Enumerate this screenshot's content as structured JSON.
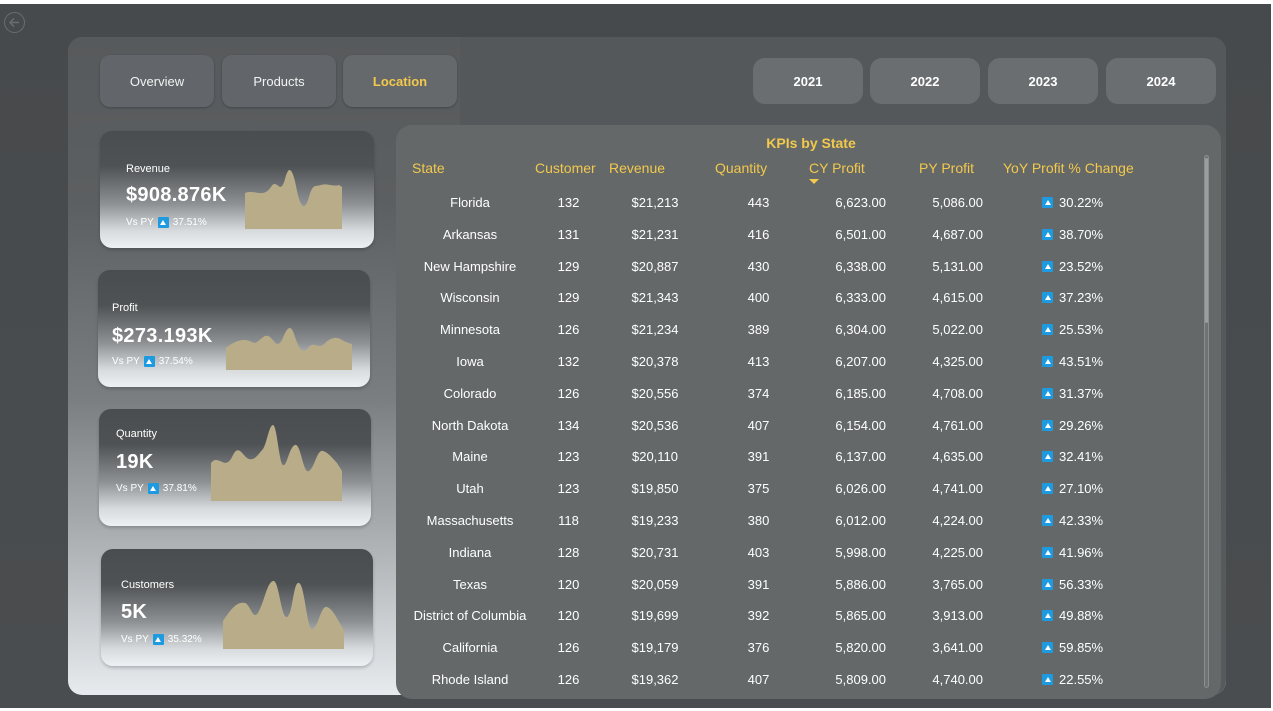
{
  "nav": {
    "tabs": [
      {
        "label": "Overview",
        "active": false
      },
      {
        "label": "Products",
        "active": false
      },
      {
        "label": "Location",
        "active": true
      }
    ],
    "years": [
      "2021",
      "2022",
      "2023",
      "2024"
    ]
  },
  "kpis": [
    {
      "title": "Revenue",
      "value": "$908.876K",
      "vs_label": "Vs PY",
      "change": "37.51%"
    },
    {
      "title": "Profit",
      "value": "$273.193K",
      "vs_label": "Vs PY",
      "change": "37.54%"
    },
    {
      "title": "Quantity",
      "value": "19K",
      "vs_label": "Vs PY",
      "change": "37.81%"
    },
    {
      "title": "Customers",
      "value": "5K",
      "vs_label": "Vs PY",
      "change": "35.32%"
    }
  ],
  "table": {
    "title": "KPIs by State",
    "sorted_by": "CY Profit",
    "columns": [
      "State",
      "Customer",
      "Revenue",
      "Quantity",
      "CY Profit",
      "PY Profit",
      "YoY Profit % Change"
    ],
    "rows": [
      [
        "Florida",
        "132",
        "$21,213",
        "443",
        "6,623.00",
        "5,086.00",
        "30.22%"
      ],
      [
        "Arkansas",
        "131",
        "$21,231",
        "416",
        "6,501.00",
        "4,687.00",
        "38.70%"
      ],
      [
        "New Hampshire",
        "129",
        "$20,887",
        "430",
        "6,338.00",
        "5,131.00",
        "23.52%"
      ],
      [
        "Wisconsin",
        "129",
        "$21,343",
        "400",
        "6,333.00",
        "4,615.00",
        "37.23%"
      ],
      [
        "Minnesota",
        "126",
        "$21,234",
        "389",
        "6,304.00",
        "5,022.00",
        "25.53%"
      ],
      [
        "Iowa",
        "132",
        "$20,378",
        "413",
        "6,207.00",
        "4,325.00",
        "43.51%"
      ],
      [
        "Colorado",
        "126",
        "$20,556",
        "374",
        "6,185.00",
        "4,708.00",
        "31.37%"
      ],
      [
        "North Dakota",
        "134",
        "$20,536",
        "407",
        "6,154.00",
        "4,761.00",
        "29.26%"
      ],
      [
        "Maine",
        "123",
        "$20,110",
        "391",
        "6,137.00",
        "4,635.00",
        "32.41%"
      ],
      [
        "Utah",
        "123",
        "$19,850",
        "375",
        "6,026.00",
        "4,741.00",
        "27.10%"
      ],
      [
        "Massachusetts",
        "118",
        "$19,233",
        "380",
        "6,012.00",
        "4,224.00",
        "42.33%"
      ],
      [
        "Indiana",
        "128",
        "$20,731",
        "403",
        "5,998.00",
        "4,225.00",
        "41.96%"
      ],
      [
        "Texas",
        "120",
        "$20,059",
        "391",
        "5,886.00",
        "3,765.00",
        "56.33%"
      ],
      [
        "District of Columbia",
        "120",
        "$19,699",
        "392",
        "5,865.00",
        "3,913.00",
        "49.88%"
      ],
      [
        "California",
        "126",
        "$19,179",
        "376",
        "5,820.00",
        "3,641.00",
        "59.85%"
      ],
      [
        "Rhode Island",
        "126",
        "$19,362",
        "407",
        "5,809.00",
        "4,740.00",
        "22.55%"
      ]
    ]
  },
  "colors": {
    "accent": "#f2c94c",
    "up_badge": "#1e9be0",
    "sparkline_fill": "#b8ad88"
  }
}
